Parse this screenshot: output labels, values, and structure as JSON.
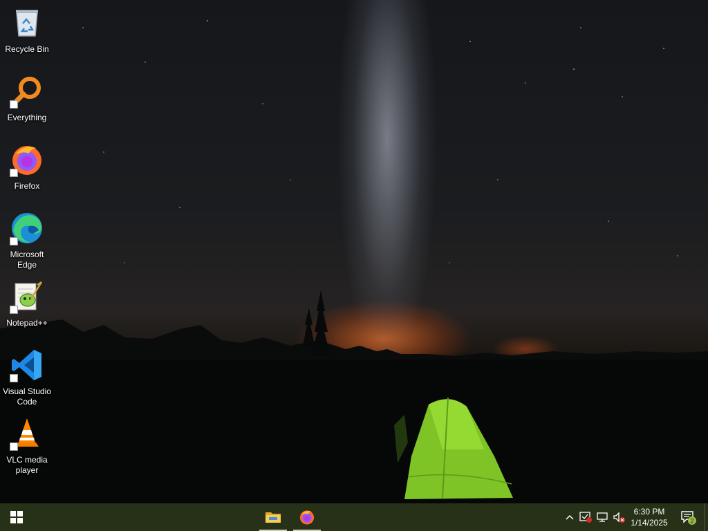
{
  "desktop": {
    "icons": [
      {
        "label": "Recycle Bin",
        "icon": "recycle-bin-icon"
      },
      {
        "label": "Everything",
        "icon": "everything-search-icon"
      },
      {
        "label": "Firefox",
        "icon": "firefox-icon"
      },
      {
        "label": "Microsoft\nEdge",
        "icon": "edge-icon"
      },
      {
        "label": "Notepad++",
        "icon": "notepadpp-icon"
      },
      {
        "label": "Visual Studio\nCode",
        "icon": "vscode-icon"
      },
      {
        "label": "VLC media\nplayer",
        "icon": "vlc-icon"
      }
    ]
  },
  "taskbar": {
    "start": "windows-start-icon",
    "pinned": [
      "file-explorer-icon",
      "firefox-icon"
    ],
    "tray": [
      "chevron-up-icon",
      "security-icon",
      "network-icon",
      "volume-muted-icon"
    ],
    "clock": {
      "time": "6:30 PM",
      "date": "1/14/2025"
    },
    "notifications": {
      "icon": "action-center-icon",
      "count": "2"
    }
  },
  "colors": {
    "taskbar": "#273117",
    "accent": "#c9d1b7"
  }
}
